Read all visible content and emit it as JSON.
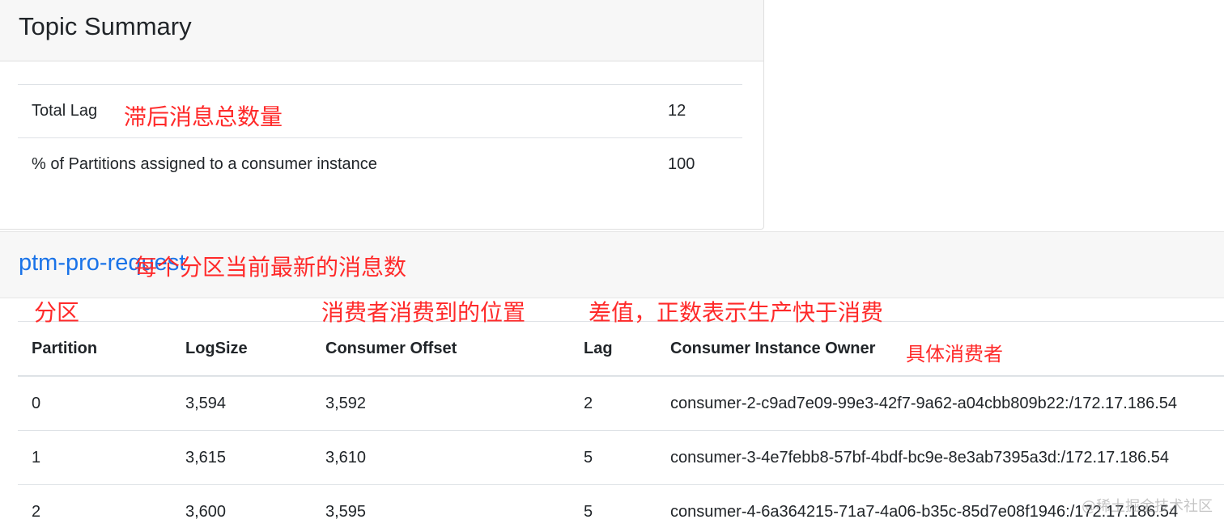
{
  "summary": {
    "title": "Topic Summary",
    "rows": [
      {
        "label": "Total Lag",
        "value": "12"
      },
      {
        "label": "% of Partitions assigned to a consumer instance",
        "value": "100"
      }
    ]
  },
  "topic": {
    "name": "ptm-pro-request"
  },
  "table": {
    "headers": [
      "Partition",
      "LogSize",
      "Consumer Offset",
      "Lag",
      "Consumer Instance Owner"
    ],
    "rows": [
      [
        "0",
        "3,594",
        "3,592",
        "2",
        "consumer-2-c9ad7e09-99e3-42f7-9a62-a04cbb809b22:/172.17.186.54"
      ],
      [
        "1",
        "3,615",
        "3,610",
        "5",
        "consumer-3-4e7febb8-57bf-4bdf-bc9e-8e3ab7395a3d:/172.17.186.54"
      ],
      [
        "2",
        "3,600",
        "3,595",
        "5",
        "consumer-4-6a364215-71a7-4a06-b35c-85d7e08f1946:/172.17.186.54"
      ]
    ]
  },
  "annotations": {
    "total_lag": "滞后消息总数量",
    "logsize": "每个分区当前最新的消息数",
    "partition": "分区",
    "offset": "消费者消费到的位置",
    "lag": "差值，正数表示生产快于消费",
    "owner": "具体消费者"
  },
  "watermark": "@稀土掘金技术社区",
  "colors": {
    "annotation": "#ff2a2a",
    "link": "#1a73e8",
    "header_bg": "#f7f7f7"
  }
}
